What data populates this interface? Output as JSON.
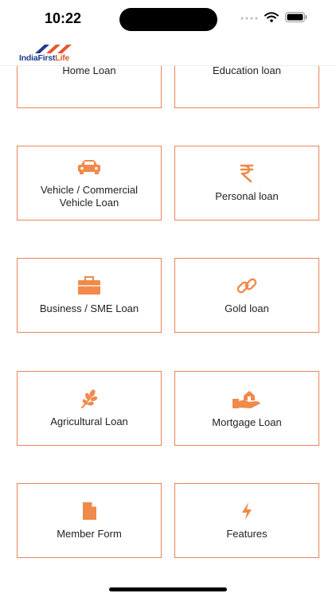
{
  "status_bar": {
    "time": "10:22"
  },
  "header": {
    "logo_text_main": "IndiaFirst",
    "logo_text_accent": "Life"
  },
  "colors": {
    "accent": "#e98558",
    "icon": "#f08a4b",
    "logo_blue": "#1f3a8a",
    "logo_red": "#e4572e"
  },
  "cards": [
    {
      "label": "Home Loan",
      "icon": "home-icon"
    },
    {
      "label": "Education loan",
      "icon": "education-icon"
    },
    {
      "label": "Vehicle / Commercial Vehicle Loan",
      "icon": "car-icon"
    },
    {
      "label": "Personal loan",
      "icon": "rupee-icon"
    },
    {
      "label": "Business / SME Loan",
      "icon": "briefcase-icon"
    },
    {
      "label": "Gold loan",
      "icon": "link-icon"
    },
    {
      "label": "Agricultural Loan",
      "icon": "plant-icon"
    },
    {
      "label": "Mortgage Loan",
      "icon": "hand-house-icon"
    },
    {
      "label": "Member Form",
      "icon": "document-icon"
    },
    {
      "label": "Features",
      "icon": "bolt-icon"
    }
  ]
}
